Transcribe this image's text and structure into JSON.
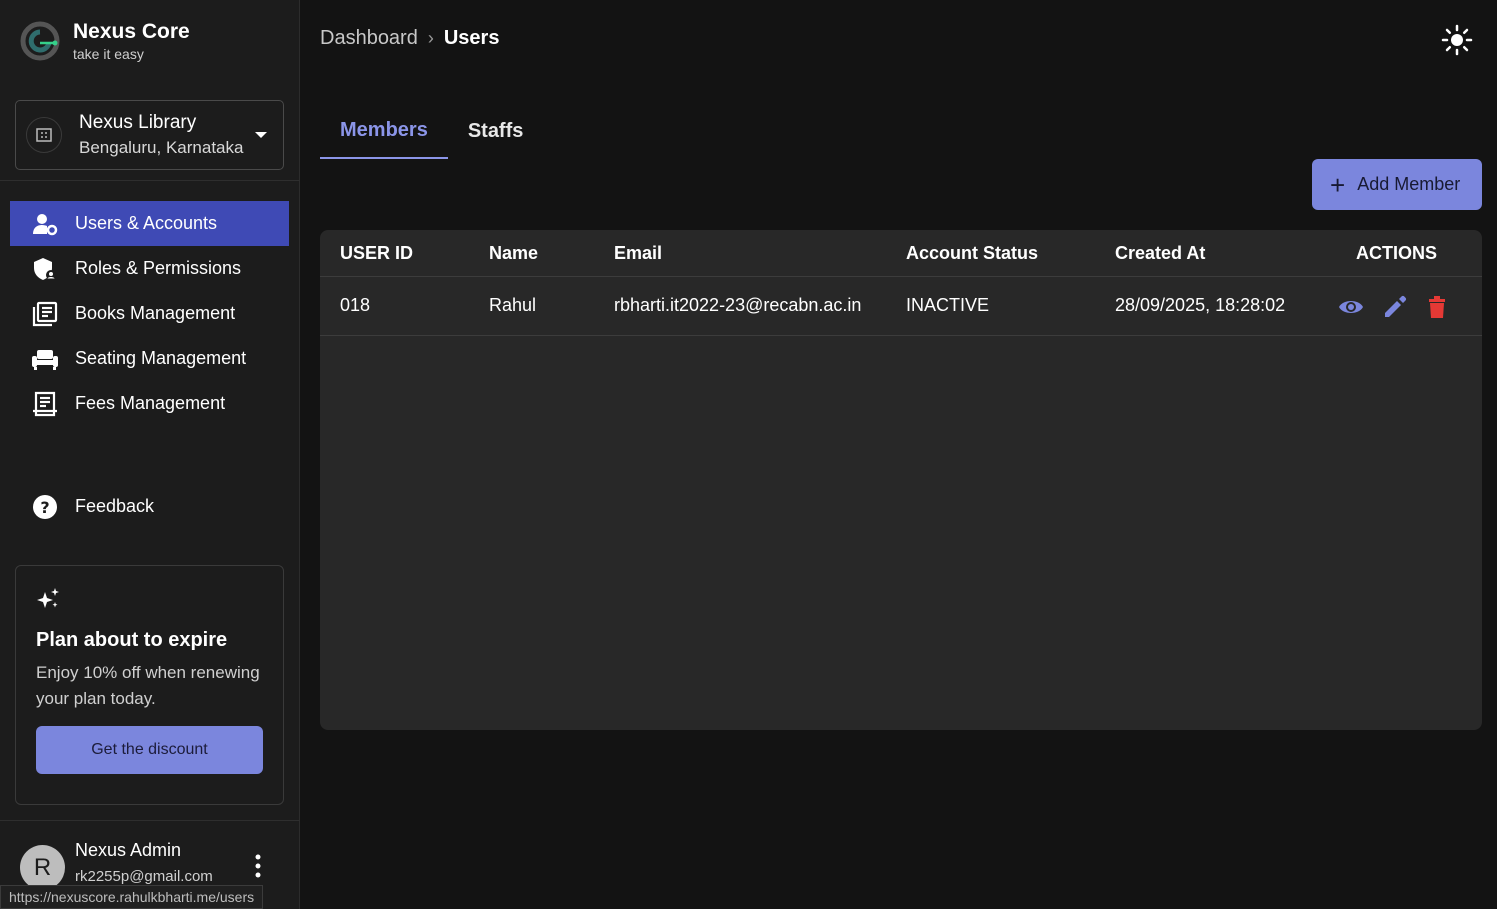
{
  "brand": {
    "name": "Nexus Core",
    "tagline": "take it easy"
  },
  "library": {
    "name": "Nexus Library",
    "location": "Bengaluru, Karnataka"
  },
  "nav": {
    "items": [
      {
        "label": "Users & Accounts",
        "icon": "users-gear-icon",
        "active": true
      },
      {
        "label": "Roles & Permissions",
        "icon": "shield-user-icon"
      },
      {
        "label": "Books Management",
        "icon": "books-icon"
      },
      {
        "label": "Seating Management",
        "icon": "sofa-icon"
      },
      {
        "label": "Fees Management",
        "icon": "receipt-icon"
      }
    ],
    "feedback_label": "Feedback"
  },
  "promo": {
    "title": "Plan about to expire",
    "text": "Enjoy 10% off when renewing your plan today.",
    "button": "Get the discount"
  },
  "user": {
    "initial": "R",
    "name": "Nexus Admin",
    "email": "rk2255p@gmail.com"
  },
  "status_url": "https://nexuscore.rahulkbharti.me/users",
  "breadcrumb": {
    "parent": "Dashboard",
    "current": "Users"
  },
  "tabs": [
    {
      "label": "Members",
      "active": true
    },
    {
      "label": "Staffs"
    }
  ],
  "add_button": "Add Member",
  "table": {
    "headers": [
      "USER ID",
      "Name",
      "Email",
      "Account Status",
      "Created At",
      "ACTIONS"
    ],
    "rows": [
      {
        "user_id": "018",
        "name": "Rahul",
        "email": "rbharti.it2022-23@recabn.ac.in",
        "status": "INACTIVE",
        "created_at": "28/09/2025, 18:28:02"
      }
    ]
  },
  "colors": {
    "accent": "#7b86dd",
    "active_nav": "#3f4ab5",
    "delete": "#e53935",
    "tab_active": "#8b95e8"
  }
}
